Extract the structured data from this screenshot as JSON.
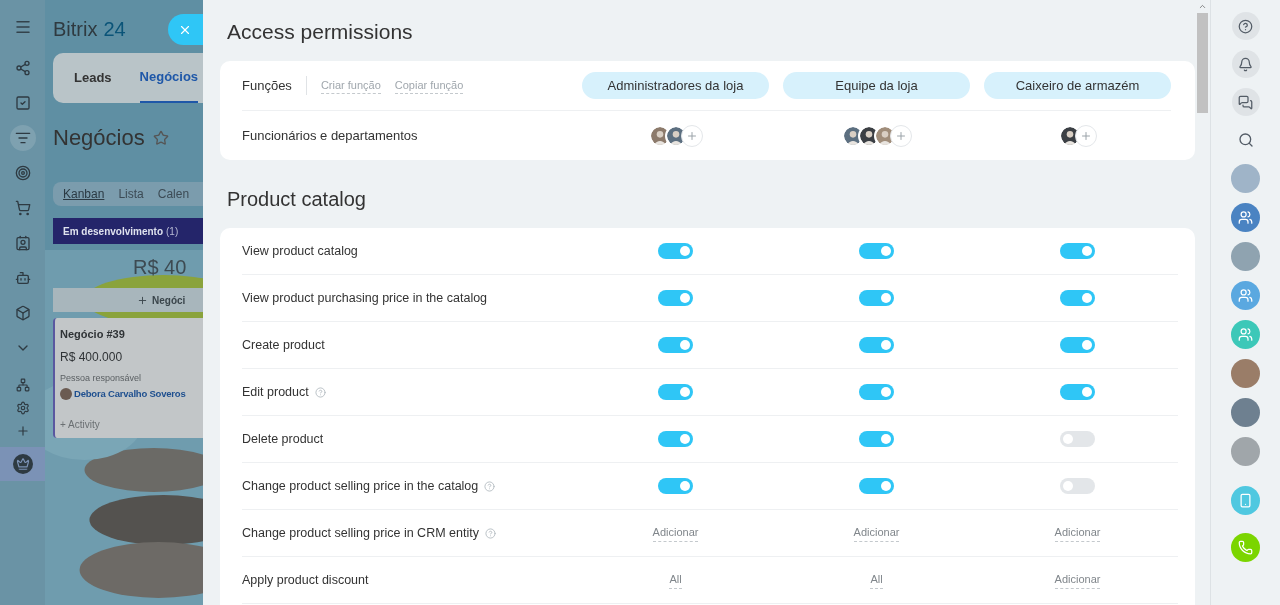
{
  "crm": {
    "logo": {
      "name": "Bitrix",
      "number": "24"
    },
    "tabs": [
      {
        "label": "Leads",
        "selected": false
      },
      {
        "label": "Negócios",
        "selected": true
      }
    ],
    "title": "Negócios",
    "views": [
      {
        "label": "Kanban",
        "selected": true
      },
      {
        "label": "Lista",
        "selected": false
      },
      {
        "label": "Calen",
        "selected": false
      }
    ],
    "stage": {
      "name": "Em desenvolvimento",
      "count": "(1)",
      "total": "R$ 40"
    },
    "add_deal": "Negóci",
    "deal": {
      "title": "Negócio #39",
      "amount": "R$ 400.000",
      "responsible_label": "Pessoa responsável",
      "responsible": "Debora Carvalho Soveros",
      "activity": "+ Activity"
    }
  },
  "panel": {
    "title": "Access permissions",
    "roles_label": "Funções",
    "actions": [
      "Criar função",
      "Copiar função"
    ],
    "employees_label": "Funcionários e departamentos",
    "roles": [
      {
        "name": "Administradores da loja"
      },
      {
        "name": "Equipe da loja"
      },
      {
        "name": "Caixeiro de armazém"
      }
    ],
    "section": "Product catalog",
    "permissions": [
      {
        "label": "View product catalog",
        "help": false,
        "values": [
          {
            "kind": "toggle",
            "on": true
          },
          {
            "kind": "toggle",
            "on": true
          },
          {
            "kind": "toggle",
            "on": true
          }
        ]
      },
      {
        "label": "View product purchasing price in the catalog",
        "help": false,
        "values": [
          {
            "kind": "toggle",
            "on": true
          },
          {
            "kind": "toggle",
            "on": true
          },
          {
            "kind": "toggle",
            "on": true
          }
        ]
      },
      {
        "label": "Create product",
        "help": false,
        "values": [
          {
            "kind": "toggle",
            "on": true
          },
          {
            "kind": "toggle",
            "on": true
          },
          {
            "kind": "toggle",
            "on": true
          }
        ]
      },
      {
        "label": "Edit product",
        "help": true,
        "values": [
          {
            "kind": "toggle",
            "on": true
          },
          {
            "kind": "toggle",
            "on": true
          },
          {
            "kind": "toggle",
            "on": true
          }
        ]
      },
      {
        "label": "Delete product",
        "help": false,
        "values": [
          {
            "kind": "toggle",
            "on": true
          },
          {
            "kind": "toggle",
            "on": true
          },
          {
            "kind": "toggle",
            "on": false
          }
        ]
      },
      {
        "label": "Change product selling price in the catalog",
        "help": true,
        "values": [
          {
            "kind": "toggle",
            "on": true
          },
          {
            "kind": "toggle",
            "on": true
          },
          {
            "kind": "toggle",
            "on": false
          }
        ]
      },
      {
        "label": "Change product selling price in CRM entity",
        "help": true,
        "values": [
          {
            "kind": "link",
            "text": "Adicionar"
          },
          {
            "kind": "link",
            "text": "Adicionar"
          },
          {
            "kind": "link",
            "text": "Adicionar"
          }
        ]
      },
      {
        "label": "Apply product discount",
        "help": false,
        "values": [
          {
            "kind": "link",
            "text": "All"
          },
          {
            "kind": "link",
            "text": "All"
          },
          {
            "kind": "link",
            "text": "Adicionar"
          }
        ]
      }
    ]
  }
}
